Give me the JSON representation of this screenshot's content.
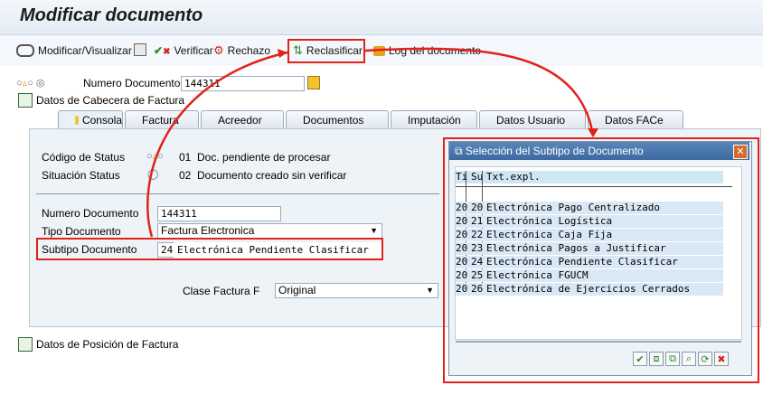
{
  "title": "Modificar documento",
  "toolbar": {
    "modificar": "Modificar/Visualizar",
    "verificar": "Verificar",
    "rechazo": "Rechazo",
    "reclasificar": "Reclasificar",
    "log": "Log del documento"
  },
  "header": {
    "numero_label": "Numero Documento",
    "numero_value": "144311",
    "cabecera": "Datos de Cabecera de Factura"
  },
  "tabs": [
    "Consola",
    "Factura",
    "Acreedor",
    "Documentos",
    "Imputación",
    "Datos Usuario",
    "Datos FACe"
  ],
  "panel": {
    "codigo_status_label": "Código de Status",
    "codigo_status_value": "01  Doc. pendiente de procesar",
    "situacion_label": "Situación Status",
    "situacion_value": "02  Documento creado sin verificar",
    "numero_doc_label": "Numero Documento",
    "numero_doc_value": "144311",
    "tipo_label": "Tipo Documento",
    "tipo_value": "Factura Electronica",
    "subtipo_label": "Subtipo Documento",
    "subtipo_code": "24",
    "subtipo_text": "Electrónica Pendiente Clasificar",
    "clase_label": "Clase Factura F",
    "clase_value": "Original"
  },
  "posicion": "Datos de Posición de Factura",
  "popup": {
    "title": "Selección del Subtipo de Documento",
    "headers": [
      "Ti",
      "Su",
      "Txt.expl."
    ],
    "rows": [
      {
        "ti": "20",
        "su": "20",
        "txt": "Electrónica Pago Centralizado"
      },
      {
        "ti": "20",
        "su": "21",
        "txt": "Electrónica Logística"
      },
      {
        "ti": "20",
        "su": "22",
        "txt": "Electrónica Caja Fija"
      },
      {
        "ti": "20",
        "su": "23",
        "txt": "Electrónica Pagos a Justificar"
      },
      {
        "ti": "20",
        "su": "24",
        "txt": "Electrónica Pendiente Clasificar"
      },
      {
        "ti": "20",
        "su": "25",
        "txt": "Electrónica FGUCM"
      },
      {
        "ti": "20",
        "su": "26",
        "txt": "Electrónica de Ejercicios Cerrados"
      }
    ]
  },
  "colors": {
    "accent_red": "#e0221b",
    "title_blue": "#3b6aa1"
  }
}
